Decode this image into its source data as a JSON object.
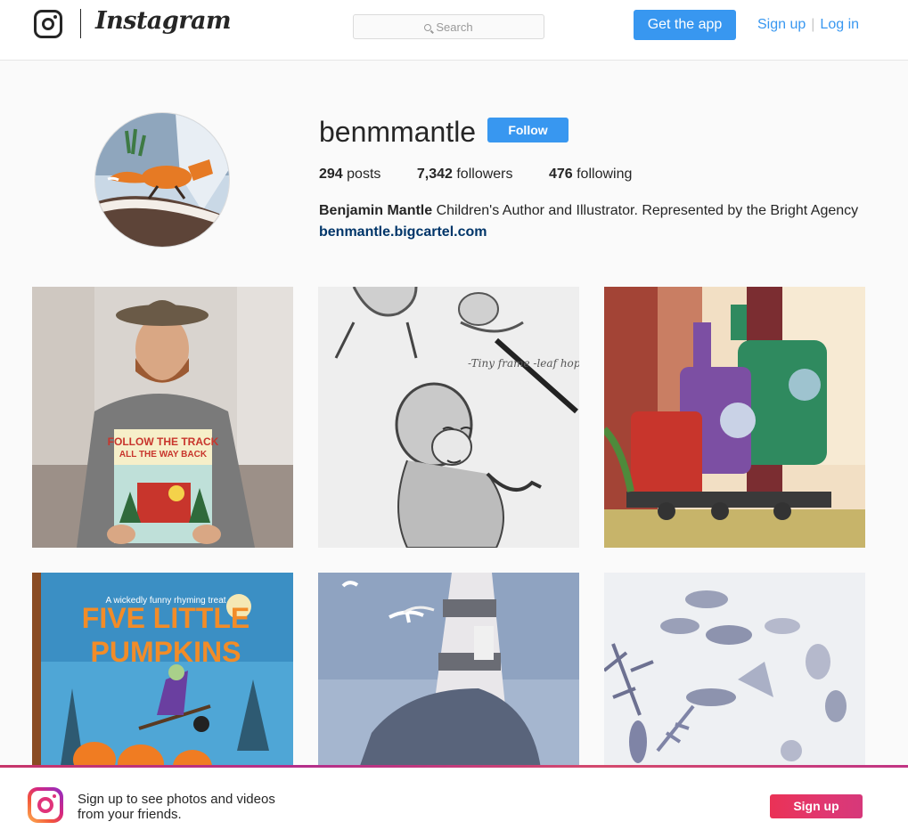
{
  "header": {
    "wordmark": "Instagram",
    "search_placeholder": "Search",
    "get_app_label": "Get the app",
    "signup_label": "Sign up",
    "login_label": "Log in",
    "separator": "|"
  },
  "profile": {
    "username": "benmmantle",
    "follow_label": "Follow",
    "posts_count": "294",
    "posts_label": "posts",
    "followers_count": "7,342",
    "followers_label": "followers",
    "following_count": "476",
    "following_label": "following",
    "full_name": "Benjamin Mantle",
    "bio": "Children's Author and Illustrator. Represented by the Bright Agency",
    "website": "benmantle.bigcartel.com"
  },
  "posts": [
    {
      "title_line1": "FOLLOW THE TRACK",
      "title_line2": "ALL THE WAY BACK",
      "icon": "photo-man-with-book"
    },
    {
      "sketch_note": "-Tiny frame -leaf hops",
      "icon": "photo-monkey-sketch"
    },
    {
      "icon": "photo-train-illustration"
    },
    {
      "tagline": "A wickedly funny rhyming treat",
      "title_line1": "FIVE LITTLE",
      "title_line2": "PUMPKINS",
      "icon": "photo-pumpkins-book"
    },
    {
      "icon": "photo-lighthouse-illustration"
    },
    {
      "icon": "photo-sketches-pieces"
    }
  ],
  "footer_banner": {
    "text_line1": "Sign up to see photos and videos",
    "text_line2": "from your friends.",
    "signup_label": "Sign up"
  },
  "colors": {
    "accent": "#3897f0",
    "link": "#003569",
    "banner_gradient_start": "#ea3256"
  }
}
